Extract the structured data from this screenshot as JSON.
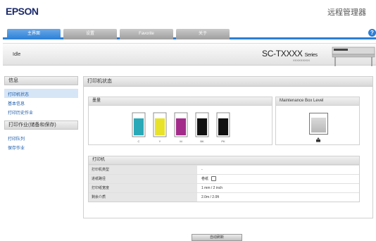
{
  "brand": "EPSON",
  "header_title": "远程管理器",
  "tabs": [
    {
      "label": "主界面",
      "active": true
    },
    {
      "label": "设置",
      "active": false
    },
    {
      "label": "Favorite",
      "active": false
    },
    {
      "label": "关于",
      "active": false
    }
  ],
  "help_icon": "help-icon",
  "banner": {
    "status": "Idle",
    "model": "SC-TXXXX",
    "model_suffix": "Series",
    "serial": "XXXXXXXXX"
  },
  "sidebar": {
    "groups": [
      {
        "title": "信息",
        "items": [
          {
            "label": "打印机状态",
            "selected": true
          },
          {
            "label": "基本信息",
            "selected": false
          },
          {
            "label": "打印历史作业",
            "selected": false
          }
        ]
      },
      {
        "title": "打印作业(储备和保存)",
        "items": [
          {
            "label": "打印队列",
            "selected": false
          },
          {
            "label": "保存作业",
            "selected": false
          }
        ]
      }
    ]
  },
  "main": {
    "title": "打印机状态",
    "ink": {
      "title": "墨量",
      "cartridges": [
        {
          "code": "C",
          "color": "#2aa9b8",
          "level": 0.8
        },
        {
          "code": "Y",
          "color": "#e8e22a",
          "level": 0.8
        },
        {
          "code": "M",
          "color": "#a32c8a",
          "level": 0.8
        },
        {
          "code": "BK",
          "color": "#111111",
          "level": 0.8
        },
        {
          "code": "PK",
          "color": "#111111",
          "level": 0.8
        }
      ]
    },
    "maintenance": {
      "title": "Maintenance Box Level",
      "level": 0.85
    },
    "printer_info": {
      "title": "打印机",
      "rows": [
        {
          "key": "打印机类型",
          "value": "-",
          "paper_icon": false
        },
        {
          "key": "进纸路径",
          "value": "卷纸",
          "paper_icon": true
        },
        {
          "key": "打印纸宽度",
          "value": "1 mm / 2 inch",
          "paper_icon": false
        },
        {
          "key": "剩余介质",
          "value": "2.0m / 2.0ft",
          "paper_icon": false
        }
      ]
    }
  },
  "footer_button": "自动刷新"
}
